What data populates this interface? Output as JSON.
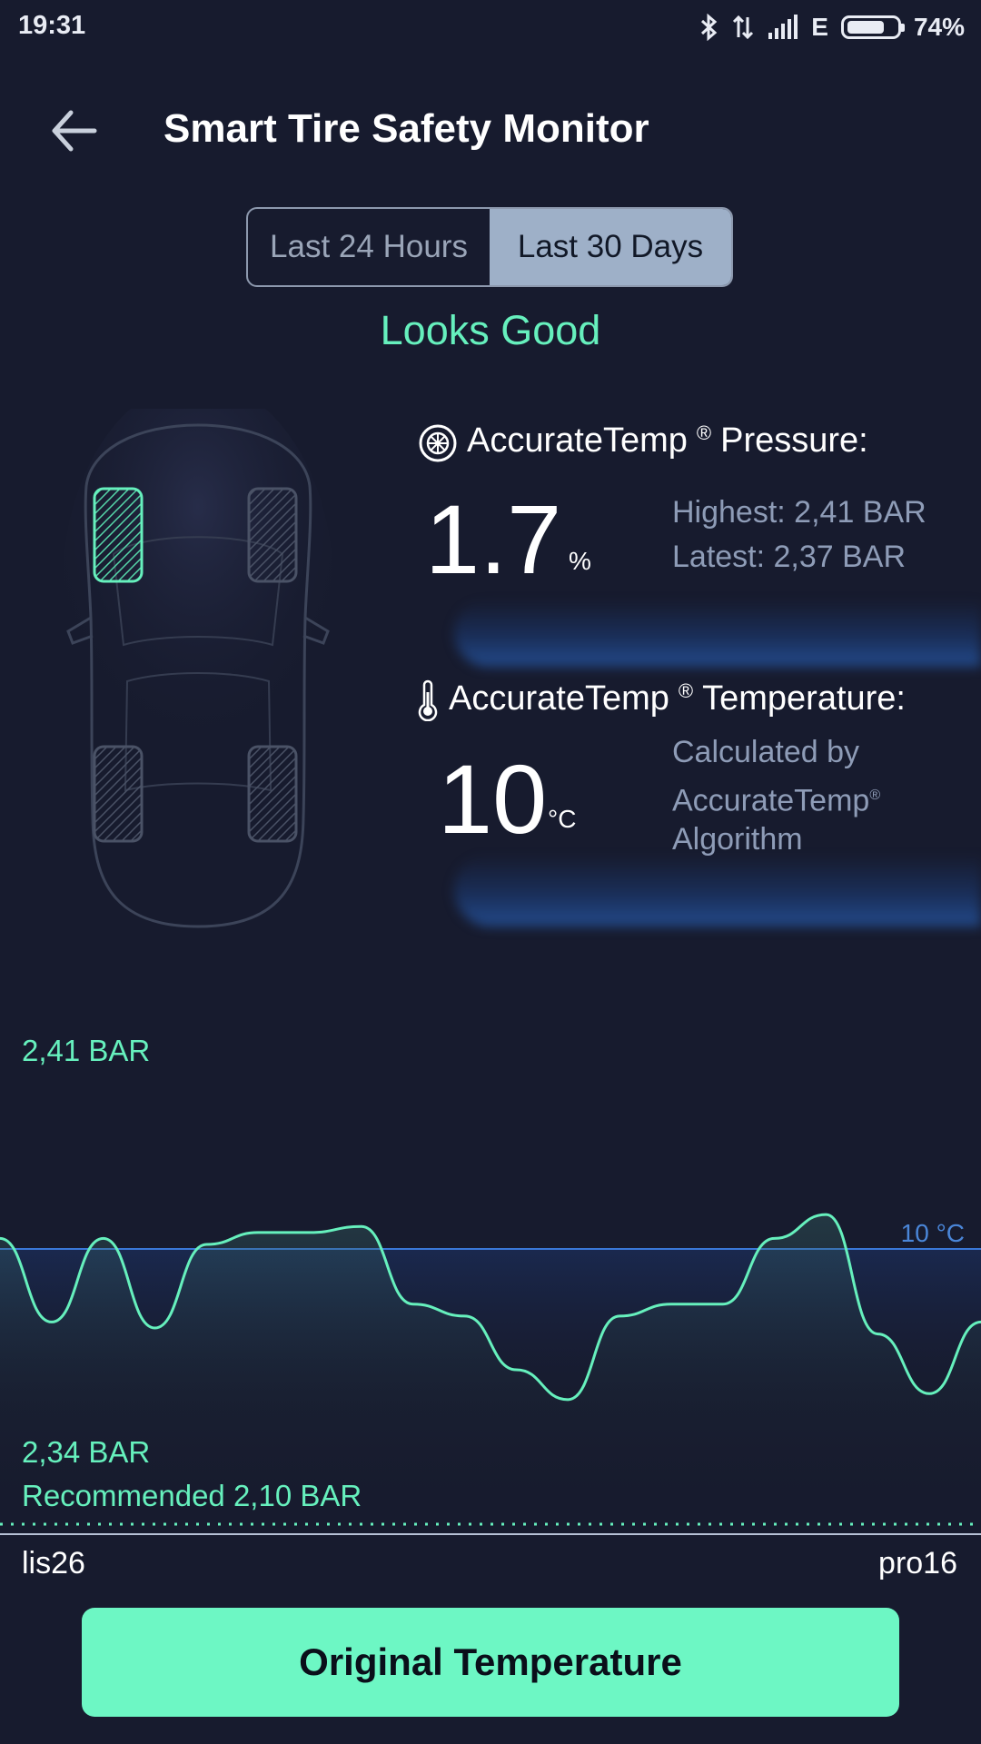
{
  "status_bar": {
    "time": "19:31",
    "network": "E",
    "battery_percent": "74%",
    "battery_level": 0.74
  },
  "header": {
    "title": "Smart Tire Safety Monitor"
  },
  "tabs": [
    {
      "label": "Last 24 Hours",
      "selected": false
    },
    {
      "label": "Last 30 Days",
      "selected": true
    }
  ],
  "status_text": "Looks Good",
  "pressure": {
    "heading": "AccurateTemp",
    "heading_suffix": "Pressure:",
    "registered": "®",
    "value": "1.7",
    "unit": "%",
    "highest": "Highest: 2,41 BAR",
    "latest": "Latest: 2,37 BAR"
  },
  "temperature": {
    "heading": "AccurateTemp",
    "heading_suffix": "Temperature:",
    "registered": "®",
    "value": "10",
    "unit": "°C",
    "desc_line1": "Calculated by",
    "desc_line2": "AccurateTemp",
    "desc_line3": "Algorithm"
  },
  "chart_data": {
    "type": "line",
    "max_label": "2,41 BAR",
    "min_label": "2,34 BAR",
    "recommended_label": "Recommended 2,10 BAR",
    "temperature_label": "10 °C",
    "x_start_label": "lis26",
    "x_end_label": "pro16",
    "series": [
      {
        "values": [
          2.376,
          2.362,
          2.376,
          2.361,
          2.375,
          2.377,
          2.377,
          2.378,
          2.365,
          2.363,
          2.354,
          2.349,
          2.363,
          2.365,
          2.365,
          2.376,
          2.38,
          2.36,
          2.35,
          2.362
        ]
      }
    ],
    "colors": {
      "line": "#66f0bd",
      "temperature_line": "#3a78d8",
      "recommended_line": "#66f0bd"
    }
  },
  "button": {
    "label": "Original Temperature"
  },
  "colors": {
    "accent": "#66f0bd",
    "background": "#171b2e",
    "button": "#6df7c4"
  }
}
